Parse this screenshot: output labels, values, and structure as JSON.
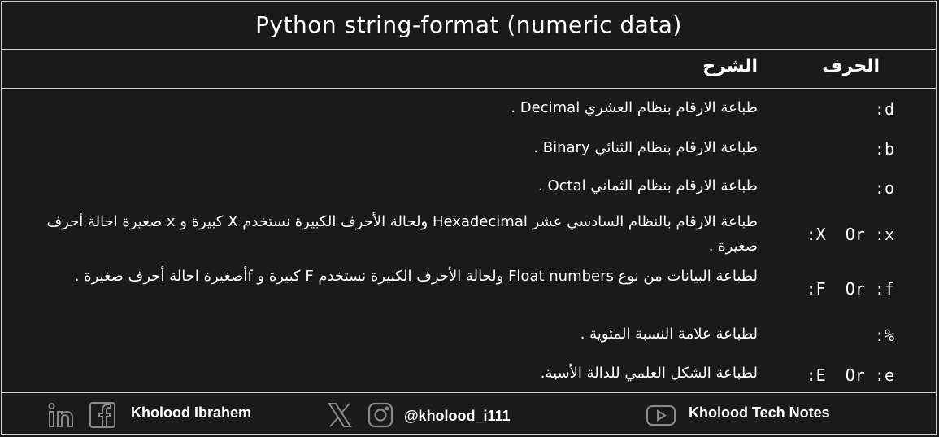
{
  "title": "Python string-format (numeric data)",
  "header": {
    "char_label": "الحرف",
    "desc_label": "الشرح"
  },
  "rows": [
    {
      "code": ":d",
      "desc": "طباعة الارقام بنظام العشري Decimal ."
    },
    {
      "code": ":b",
      "desc": "طباعة الارقام بنظام الثنائي Binary ."
    },
    {
      "code": ":o",
      "desc": "طباعة الارقام بنظام الثماني Octal ."
    },
    {
      "code": ":X  Or :x",
      "desc": "طباعة الارقام بالنظام السادسي عشر  Hexadecimal  ولحالة الأحرف الكبيرة نستخدم X  كبيرة و x  صغيرة احالة أحرف صغيرة ."
    },
    {
      "code": ":F  Or :f",
      "desc": "لطباعة البيانات  من نوع  Float numbers  ولحالة الأحرف الكبيرة نستخدم F  كبيرة و  fأصغيرة احالة أحرف صغيرة ."
    },
    {
      "code": ":%",
      "desc": "لطباعة علامة النسبة المئوية ."
    },
    {
      "code": ":E  Or :e",
      "desc": "لطباعة الشكل العلمي للدالة الأسية."
    }
  ],
  "footer": {
    "name": "Kholood Ibrahem",
    "handle": "@kholood_i111",
    "channel": "Kholood Tech Notes",
    "icons": [
      "linkedin-icon",
      "facebook-icon",
      "x-icon",
      "instagram-icon",
      "youtube-icon"
    ]
  }
}
